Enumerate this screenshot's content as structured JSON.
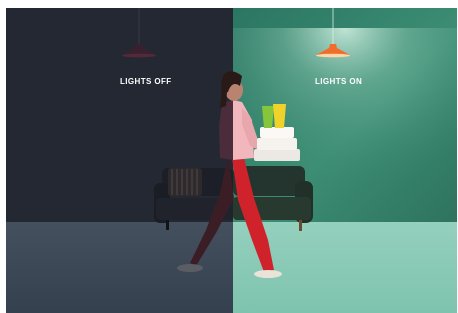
{
  "scene": {
    "left_label": "LIGHTS OFF",
    "right_label": "LIGHTS ON",
    "colors": {
      "dark_wall": "#242833",
      "dark_floor": "#3c4856",
      "light_wall": "#39876f",
      "light_floor": "#8ccbb8",
      "lamp_on": "#f16d2c",
      "lamp_off": "#3a2130",
      "sofa": "#24352f",
      "shirt": "#f2b7bd",
      "trousers": "#d0222b",
      "cup_green": "#86c63b",
      "cup_yellow": "#f0d22a"
    }
  }
}
